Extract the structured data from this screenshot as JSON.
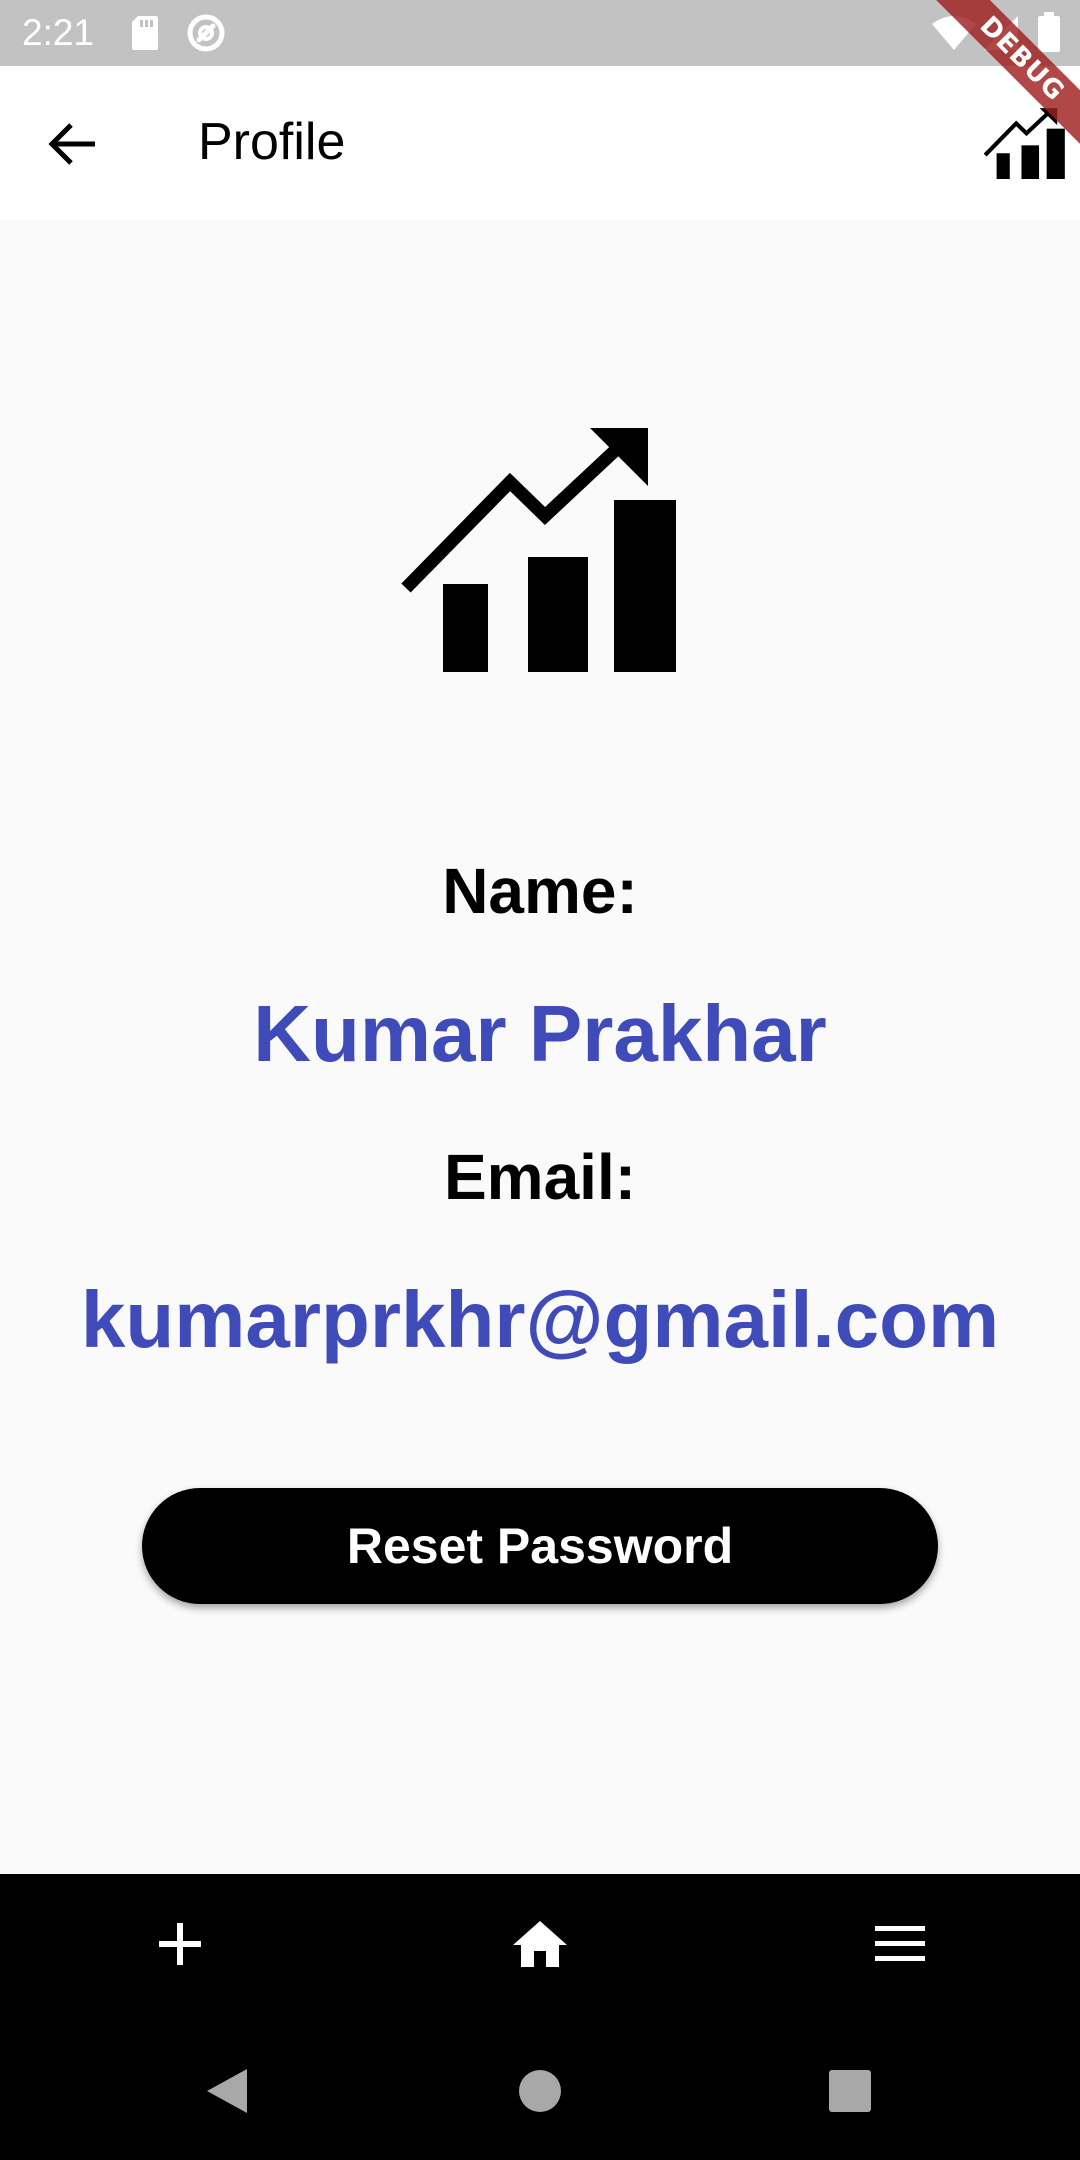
{
  "status_bar": {
    "time": "2:21",
    "icons": [
      "sd-card-icon",
      "sync-icon",
      "wifi-icon",
      "signal-icon",
      "battery-icon"
    ]
  },
  "debug_banner": "DEBUG",
  "app_bar": {
    "title": "Profile",
    "back_icon": "arrow-back-icon",
    "action_icon": "chart-growth-icon"
  },
  "profile": {
    "name_label": "Name:",
    "name_value": "Kumar Prakhar",
    "email_label": "Email:",
    "email_value": "kumarprkhr@gmail.com",
    "reset_button_label": "Reset Password"
  },
  "bottom_nav": {
    "items": [
      {
        "icon": "add-icon"
      },
      {
        "icon": "home-icon"
      },
      {
        "icon": "menu-icon"
      }
    ]
  },
  "colors": {
    "accent": "#3f4bb9",
    "status_bar": "#c2c2c2",
    "background": "#fafafa",
    "nav_background": "#000000"
  }
}
